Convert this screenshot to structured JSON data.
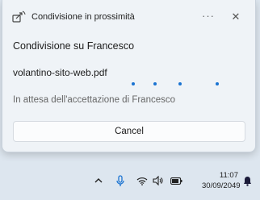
{
  "flyout": {
    "title": "Condivisione in prossimità",
    "more_label": "···",
    "close_label": "✕",
    "target_text": "Condivisione su Francesco",
    "filename": "volantino-sito-web.pdf",
    "status_text": "In attesa dell'accettazione di Francesco",
    "cancel_label": "Cancel",
    "progress_dots": 4
  },
  "taskbar": {
    "icons": [
      "chevron-up-icon",
      "microphone-icon",
      "wifi-icon",
      "speaker-icon",
      "battery-icon",
      "notification-bell-icon"
    ],
    "time": "11:07",
    "date": "30/09/2049"
  },
  "colors": {
    "accent": "#1a73d1",
    "panel_bg": "#eff3f7",
    "taskbar_bg": "#dde6ef"
  }
}
